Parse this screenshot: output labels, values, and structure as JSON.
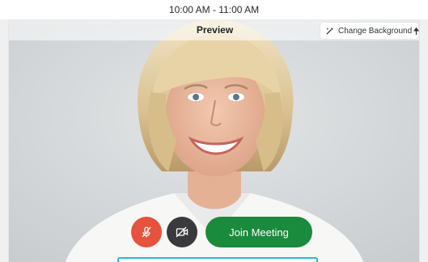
{
  "meeting": {
    "time_range": "10:00 AM - 11:00 AM"
  },
  "preview": {
    "title": "Preview"
  },
  "toolbar": {
    "change_background_label": "Change Background",
    "change_background_icon": "magic-wand-icon",
    "pip_icon": "picture-in-picture-icon"
  },
  "controls": {
    "mute_icon": "microphone-muted-icon",
    "video_icon": "camera-off-icon",
    "join_label": "Join Meeting"
  },
  "colors": {
    "mute_button": "#e5533d",
    "video_button": "#3a3a3c",
    "join_button": "#1a8a3c",
    "focus_border": "#27b4e6"
  }
}
